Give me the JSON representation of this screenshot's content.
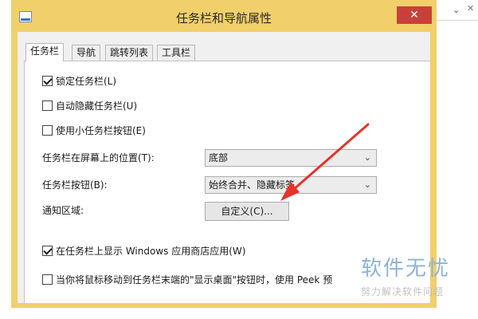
{
  "window": {
    "title": "任务栏和导航属性",
    "close_label": "✕"
  },
  "tabs": [
    "任务栏",
    "导航",
    "跳转列表",
    "工具栏"
  ],
  "options": {
    "lock": {
      "label": "锁定任务栏(L)",
      "checked": true
    },
    "autohide": {
      "label": "自动隐藏任务栏(U)",
      "checked": false
    },
    "small": {
      "label": "使用小任务栏按钮(E)",
      "checked": false
    },
    "store": {
      "label": "在任务栏上显示 Windows 应用商店应用(W)",
      "checked": true
    },
    "peek": {
      "label": "当你将鼠标移动到任务栏末端的\"显示桌面\"按钮时，使用 Peek 预",
      "checked": false
    }
  },
  "fields": {
    "position_label": "任务栏在屏幕上的位置(T):",
    "position_value": "底部",
    "buttons_label": "任务栏按钮(B):",
    "buttons_value": "始终合并、隐藏标签",
    "notify_label": "通知区域:",
    "customize_button": "自定义(C)..."
  },
  "watermark": {
    "main": "软件无忧",
    "sub": "努力解决软件问题"
  },
  "colors": {
    "titlebar": "#f1cf6b",
    "close": "#c9403a",
    "arrow": "#e8322a",
    "watermark": "#8fb2d4"
  }
}
